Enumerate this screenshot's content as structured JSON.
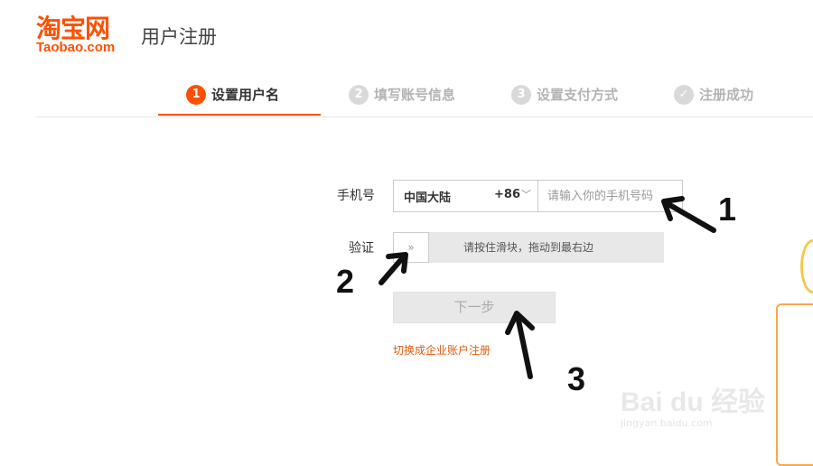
{
  "header": {
    "logo_cn": "淘宝网",
    "logo_en": "Taobao.com",
    "title": "用户注册"
  },
  "steps": [
    {
      "num": "1",
      "label": "设置用户名"
    },
    {
      "num": "2",
      "label": "填写账号信息"
    },
    {
      "num": "3",
      "label": "设置支付方式"
    },
    {
      "num": "✓",
      "label": "注册成功"
    }
  ],
  "form": {
    "phone_label": "手机号",
    "country": "中国大陆",
    "country_code": "+86",
    "phone_placeholder": "请输入你的手机号码",
    "verify_label": "验证",
    "slider_text": "请按住滑块，拖动到最右边",
    "next_button": "下一步",
    "enterprise_link": "切换成企业账户注册"
  },
  "annotations": [
    "1",
    "2",
    "3"
  ],
  "watermark": {
    "text": "Bai du 经验",
    "sub": "jingyan.baidu.com"
  },
  "colors": {
    "brand": "#ff5000",
    "link": "#e35a0b"
  }
}
